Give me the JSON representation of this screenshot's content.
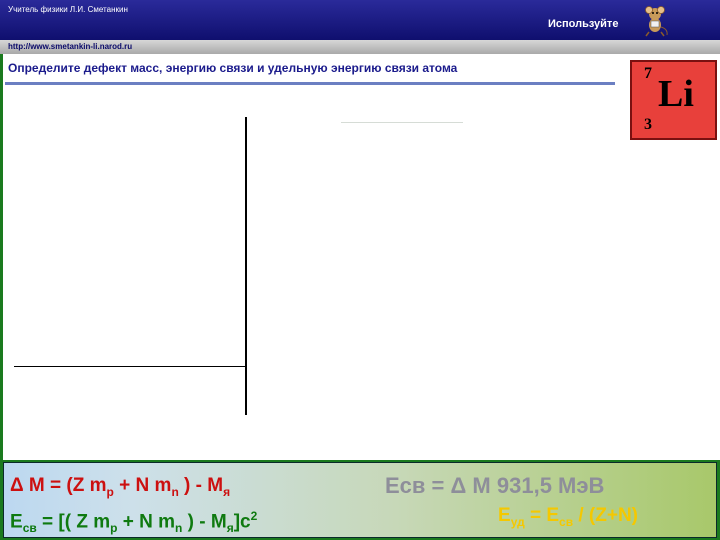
{
  "header": {
    "author": "Учитель физики Л.И. Сметанкин",
    "use_label": "Используйте",
    "url": "http://www.smetankin-li.narod.ru"
  },
  "task": {
    "title": "Определите  дефект масс, энергию связи и удельную энергию связи атома"
  },
  "element": {
    "symbol": "Li",
    "mass_number": "7",
    "atomic_number": "3"
  },
  "formulas": {
    "f1": {
      "a": "Δ M = (Z m",
      "b": "p",
      "c": " + N m",
      "d": "n",
      "e": " ) - M",
      "f": "я"
    },
    "f2": {
      "a": "E",
      "b": "св",
      "c": " = [( Z m",
      "d": "p",
      "e": " + N m",
      "f": "n",
      "g": "  ) - M",
      "h": "я",
      "i": "]c",
      "j": "2"
    },
    "f3": "Eсв  = Δ M 931,5 МэВ",
    "f4": {
      "a": "E",
      "b": "уд",
      "c": " = E",
      "d": "св",
      "e": " / (Z+N)"
    }
  },
  "colors": {
    "header_bg": "#1a1a80",
    "slide_bg": "#1a7a1e",
    "f1": "#cc1010",
    "f2": "#0f7a10",
    "f3": "#8e8e9a",
    "f4": "#f5c800",
    "element_bg": "#e8403b"
  }
}
